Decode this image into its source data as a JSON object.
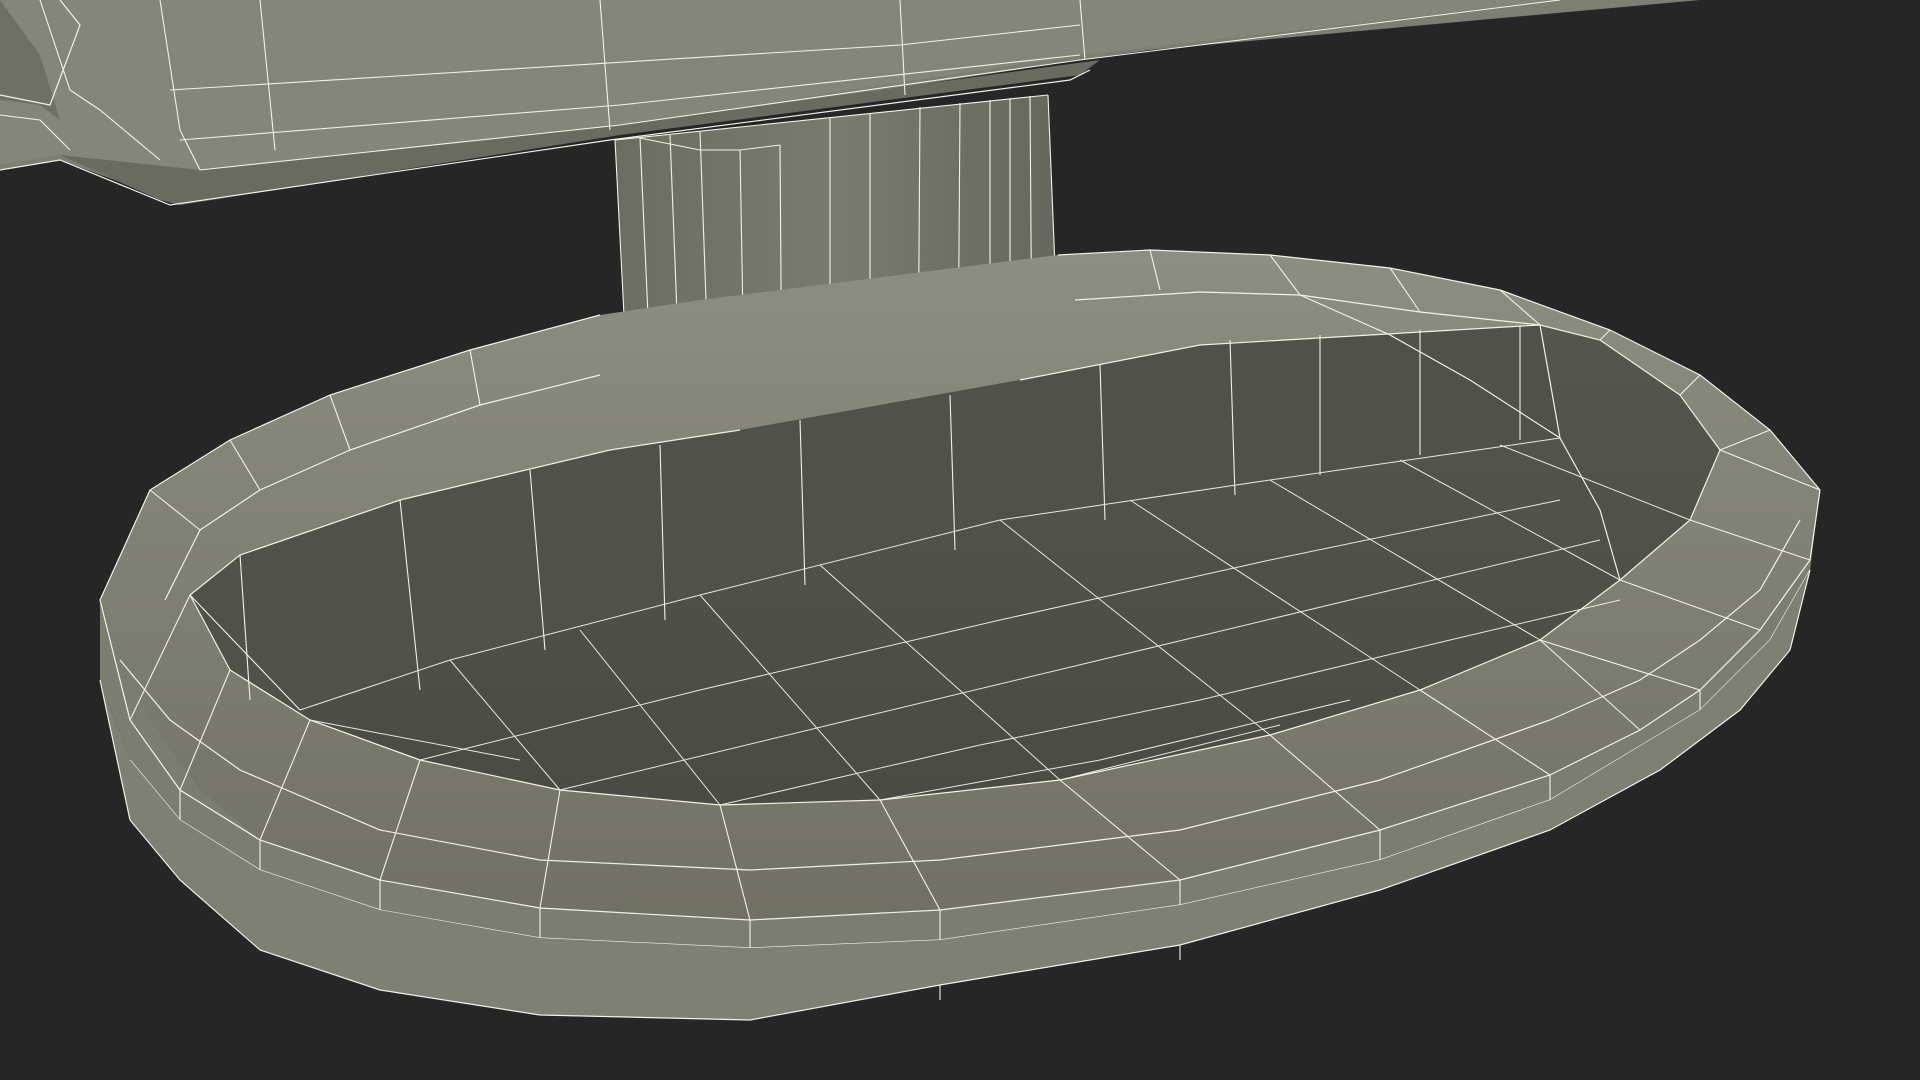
{
  "viewport": {
    "background_color": "#262626",
    "model_fill_color": "#8a8b7e",
    "model_shadow_color": "#4f5048",
    "wireframe_color": "#f2f1e6"
  },
  "model": {
    "icon": "wireframe-monitor-stand-icon"
  }
}
